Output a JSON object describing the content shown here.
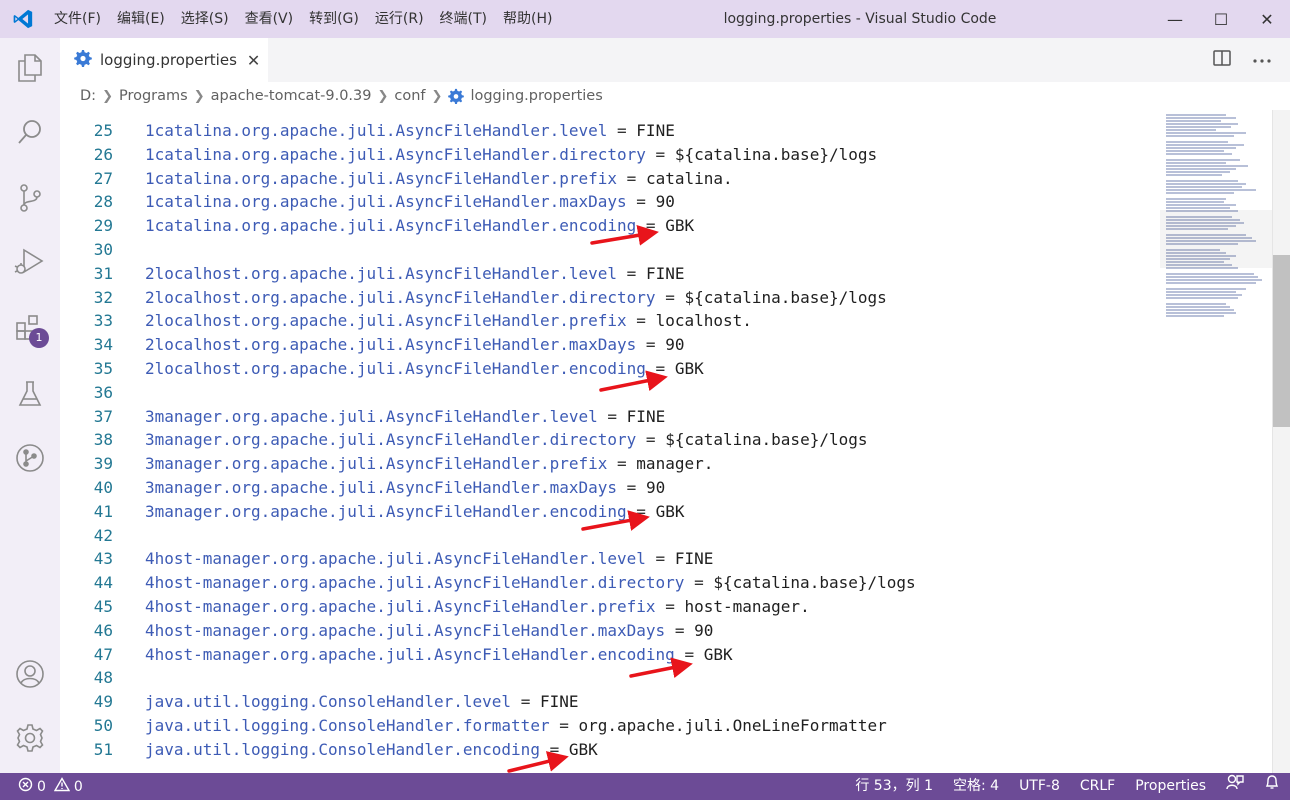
{
  "window": {
    "title": "logging.properties - Visual Studio Code",
    "menu": [
      "文件(F)",
      "编辑(E)",
      "选择(S)",
      "查看(V)",
      "转到(G)",
      "运行(R)",
      "终端(T)",
      "帮助(H)"
    ],
    "minimize": "—",
    "maximize": "☐",
    "close": "✕"
  },
  "activity": {
    "extensions_badge": "1",
    "icons": [
      "explorer-icon",
      "search-icon",
      "source-control-icon",
      "run-debug-icon",
      "extensions-icon",
      "testing-icon",
      "git-graph-icon",
      "account-icon",
      "settings-gear-icon"
    ]
  },
  "tab": {
    "label": "logging.properties",
    "close": "✕"
  },
  "breadcrumb": {
    "items": [
      "D:",
      "Programs",
      "apache-tomcat-9.0.39",
      "conf",
      "logging.properties"
    ]
  },
  "editor": {
    "lines": [
      {
        "n": "25",
        "key": "1catalina.org.apache.juli.AsyncFileHandler.level",
        "val": "FINE"
      },
      {
        "n": "26",
        "key": "1catalina.org.apache.juli.AsyncFileHandler.directory",
        "val": "${catalina.base}/logs"
      },
      {
        "n": "27",
        "key": "1catalina.org.apache.juli.AsyncFileHandler.prefix",
        "val": "catalina."
      },
      {
        "n": "28",
        "key": "1catalina.org.apache.juli.AsyncFileHandler.maxDays",
        "val": "90"
      },
      {
        "n": "29",
        "key": "1catalina.org.apache.juli.AsyncFileHandler.encoding",
        "val": "GBK"
      },
      {
        "n": "30",
        "key": "",
        "val": ""
      },
      {
        "n": "31",
        "key": "2localhost.org.apache.juli.AsyncFileHandler.level",
        "val": "FINE"
      },
      {
        "n": "32",
        "key": "2localhost.org.apache.juli.AsyncFileHandler.directory",
        "val": "${catalina.base}/logs"
      },
      {
        "n": "33",
        "key": "2localhost.org.apache.juli.AsyncFileHandler.prefix",
        "val": "localhost."
      },
      {
        "n": "34",
        "key": "2localhost.org.apache.juli.AsyncFileHandler.maxDays",
        "val": "90"
      },
      {
        "n": "35",
        "key": "2localhost.org.apache.juli.AsyncFileHandler.encoding",
        "val": "GBK"
      },
      {
        "n": "36",
        "key": "",
        "val": ""
      },
      {
        "n": "37",
        "key": "3manager.org.apache.juli.AsyncFileHandler.level",
        "val": "FINE"
      },
      {
        "n": "38",
        "key": "3manager.org.apache.juli.AsyncFileHandler.directory",
        "val": "${catalina.base}/logs"
      },
      {
        "n": "39",
        "key": "3manager.org.apache.juli.AsyncFileHandler.prefix",
        "val": "manager."
      },
      {
        "n": "40",
        "key": "3manager.org.apache.juli.AsyncFileHandler.maxDays",
        "val": "90"
      },
      {
        "n": "41",
        "key": "3manager.org.apache.juli.AsyncFileHandler.encoding",
        "val": "GBK"
      },
      {
        "n": "42",
        "key": "",
        "val": ""
      },
      {
        "n": "43",
        "key": "4host-manager.org.apache.juli.AsyncFileHandler.level",
        "val": "FINE"
      },
      {
        "n": "44",
        "key": "4host-manager.org.apache.juli.AsyncFileHandler.directory",
        "val": "${catalina.base}/logs"
      },
      {
        "n": "45",
        "key": "4host-manager.org.apache.juli.AsyncFileHandler.prefix",
        "val": "host-manager."
      },
      {
        "n": "46",
        "key": "4host-manager.org.apache.juli.AsyncFileHandler.maxDays",
        "val": "90"
      },
      {
        "n": "47",
        "key": "4host-manager.org.apache.juli.AsyncFileHandler.encoding",
        "val": "GBK"
      },
      {
        "n": "48",
        "key": "",
        "val": ""
      },
      {
        "n": "49",
        "key": "java.util.logging.ConsoleHandler.level",
        "val": "FINE"
      },
      {
        "n": "50",
        "key": "java.util.logging.ConsoleHandler.formatter",
        "val": "org.apache.juli.OneLineFormatter"
      },
      {
        "n": "51",
        "key": "java.util.logging.ConsoleHandler.encoding",
        "val": "GBK"
      }
    ],
    "operator": "="
  },
  "status": {
    "errors": "0",
    "warnings": "0",
    "position": "行 53，列 1",
    "indent": "空格: 4",
    "encoding": "UTF-8",
    "eol": "CRLF",
    "language": "Properties"
  },
  "colors": {
    "accent": "#6c4b96",
    "titlebar": "#e3d8ef",
    "key": "#3d5bb5",
    "arrow": "#e8141b"
  }
}
